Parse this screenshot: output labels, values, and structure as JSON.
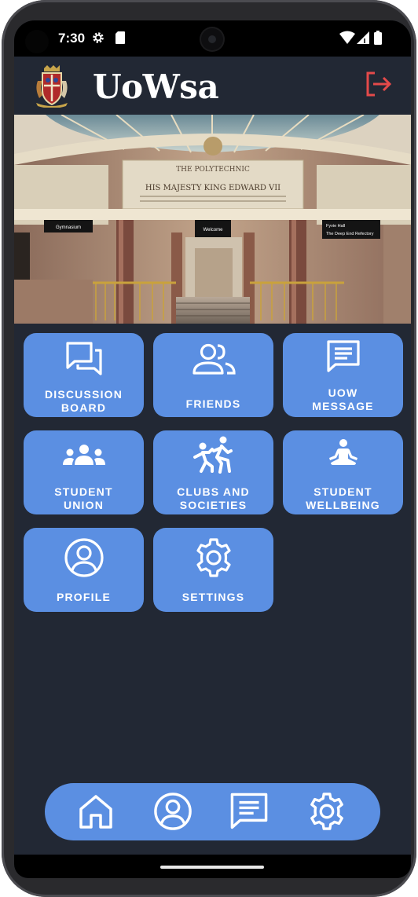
{
  "status_bar": {
    "time": "7:30",
    "icons": [
      "settings-icon",
      "sd-card-icon",
      "wifi-icon",
      "signal-icon",
      "battery-icon"
    ]
  },
  "app_bar": {
    "title": "UoWsa",
    "logo": "university-crest",
    "logout_icon": "logout-icon"
  },
  "hero": {
    "image": "building-lobby-photo",
    "sign_text": "THE POLYTECHNIC",
    "inscription": "HIS MAJESTY KING EDWARD VII",
    "signs": [
      "Gymnasium",
      "Welcome",
      "Fyvie Hall",
      "The Deep End Refectory"
    ]
  },
  "tiles": [
    {
      "id": "discussion",
      "lines": [
        "DISCUSSION",
        "BOARD"
      ],
      "icon": "discussion-icon"
    },
    {
      "id": "friends",
      "lines": [
        "FRIENDS"
      ],
      "icon": "friends-icon"
    },
    {
      "id": "message",
      "lines": [
        "UOW",
        "MESSAGE"
      ],
      "icon": "message-icon"
    },
    {
      "id": "union",
      "lines": [
        "STUDENT",
        "UNION"
      ],
      "icon": "group-icon"
    },
    {
      "id": "clubs",
      "lines": [
        "CLUBS AND",
        "SOCIETIES"
      ],
      "icon": "sports-icon"
    },
    {
      "id": "wellbeing",
      "lines": [
        "STUDENT",
        "WELLBEING"
      ],
      "icon": "meditation-icon"
    },
    {
      "id": "profile",
      "lines": [
        "PROFILE"
      ],
      "icon": "profile-icon"
    },
    {
      "id": "settings",
      "lines": [
        "SETTINGS"
      ],
      "icon": "gear-icon"
    }
  ],
  "bottom_nav": [
    "home-icon",
    "profile-icon",
    "chat-icon",
    "gear-icon"
  ],
  "colors": {
    "background": "#222834",
    "tile": "#5b8fe2",
    "logout": "#e44a4a",
    "text": "#ffffff"
  }
}
